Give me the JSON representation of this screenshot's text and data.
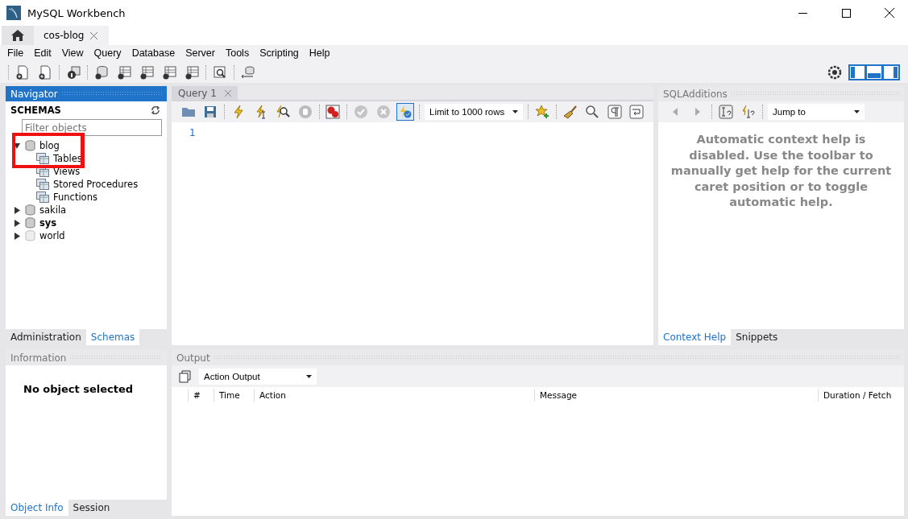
{
  "window": {
    "title": "MySQL Workbench"
  },
  "connection_tabs": [
    {
      "kind": "home",
      "selected": false
    },
    {
      "kind": "connection",
      "label": "cos-blog",
      "selected": true
    }
  ],
  "menu": [
    "File",
    "Edit",
    "View",
    "Query",
    "Database",
    "Server",
    "Tools",
    "Scripting",
    "Help"
  ],
  "navigator": {
    "title": "Navigator",
    "section": "SCHEMAS",
    "filter": {
      "placeholder": "Filter objects"
    },
    "schemas": [
      {
        "name": "blog",
        "expanded": true,
        "default": false,
        "children": [
          {
            "name": "Tables"
          },
          {
            "name": "Views"
          },
          {
            "name": "Stored Procedures"
          },
          {
            "name": "Functions"
          }
        ]
      },
      {
        "name": "sakila",
        "expanded": false,
        "default": false
      },
      {
        "name": "sys",
        "expanded": false,
        "default": true
      },
      {
        "name": "world",
        "expanded": false,
        "default": false
      }
    ],
    "tabs": [
      {
        "label": "Administration",
        "selected": false
      },
      {
        "label": "Schemas",
        "selected": true
      }
    ]
  },
  "editor": {
    "tabs": [
      {
        "label": "Query 1",
        "selected": true
      }
    ],
    "limit": "Limit to 1000 rows",
    "line_numbers": [
      "1"
    ]
  },
  "sql_additions": {
    "title": "SQLAdditions",
    "jump_to": "Jump to",
    "help_text": "Automatic context help is disabled. Use the toolbar to manually get help for the current caret position or to toggle automatic help.",
    "tabs": [
      {
        "label": "Context Help",
        "selected": true
      },
      {
        "label": "Snippets",
        "selected": false
      }
    ]
  },
  "information": {
    "title": "Information",
    "message": "No object selected",
    "tabs": [
      {
        "label": "Object Info",
        "selected": true
      },
      {
        "label": "Session",
        "selected": false
      }
    ]
  },
  "output": {
    "title": "Output",
    "selector": "Action Output",
    "columns": [
      "#",
      "Time",
      "Action",
      "Message",
      "Duration / Fetch"
    ]
  }
}
